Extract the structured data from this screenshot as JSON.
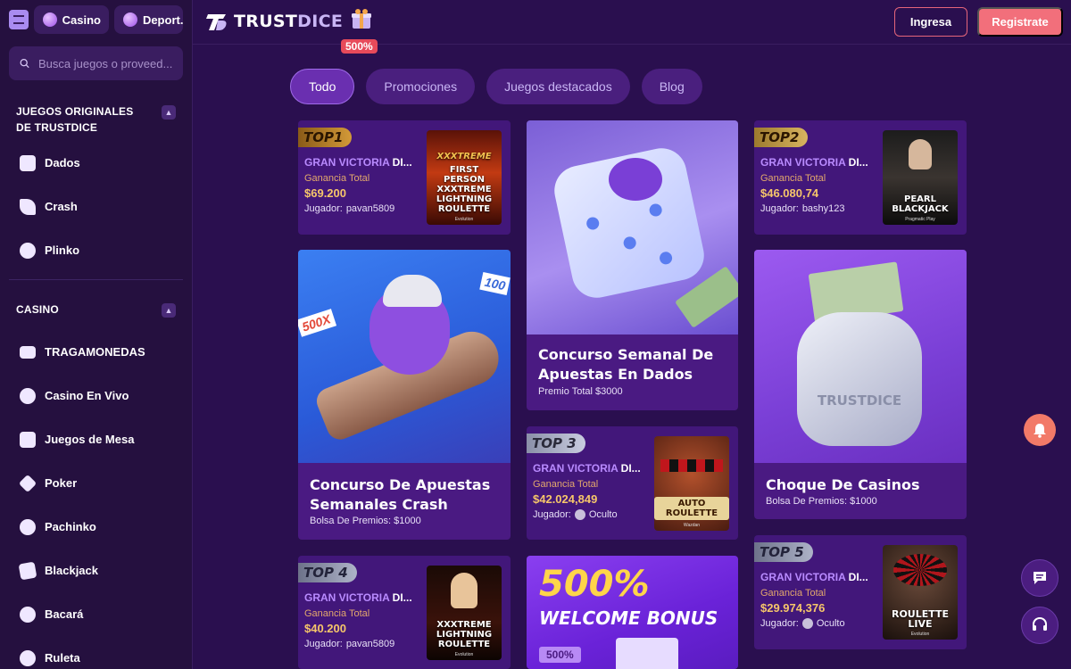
{
  "sidebar": {
    "casino_label": "Casino",
    "sports_label": "Deport...",
    "search_placeholder": "Busca juegos o proveed...",
    "originals_heading": "JUEGOS ORIGINALES DE TRUSTDICE",
    "originals": [
      {
        "label": "Dados",
        "icon": "dice-icon"
      },
      {
        "label": "Crash",
        "icon": "rocket-icon"
      },
      {
        "label": "Plinko",
        "icon": "plinko-icon"
      }
    ],
    "casino_heading": "CASINO",
    "casino_items": [
      {
        "label": "TRAGAMONEDAS",
        "icon": "slots-icon"
      },
      {
        "label": "Casino En Vivo",
        "icon": "live-dealer-icon"
      },
      {
        "label": "Juegos de Mesa",
        "icon": "table-games-icon"
      },
      {
        "label": "Poker",
        "icon": "poker-icon"
      },
      {
        "label": "Pachinko",
        "icon": "pachinko-icon"
      },
      {
        "label": "Blackjack",
        "icon": "cards-icon"
      },
      {
        "label": "Bacará",
        "icon": "club-icon"
      },
      {
        "label": "Ruleta",
        "icon": "roulette-icon"
      }
    ]
  },
  "header": {
    "logo_text_a": "TRUST",
    "logo_text_b": "DICE",
    "gift_badge": "500%",
    "login_label": "Ingresa",
    "register_label": "Registrate"
  },
  "tabs": [
    "Todo",
    "Promociones",
    "Juegos destacados",
    "Blog"
  ],
  "wins": [
    {
      "rank": "TOP1",
      "title_a": "GRAN VICTORIA",
      "title_b": " DI...",
      "label": "Ganancia Total",
      "amount": "$69.200",
      "player_prefix": "Jugador:",
      "player": "pavan5809",
      "game": "FIRST PERSON XXXTREME LIGHTNING ROULETTE",
      "game_tag": "XXXTREME",
      "provider": "Evolution"
    },
    {
      "rank": "TOP2",
      "title_a": "GRAN VICTORIA",
      "title_b": " DI...",
      "label": "Ganancia Total",
      "amount": "$46.080,74",
      "player_prefix": "Jugador:",
      "player": "bashy123",
      "game": "PEARL BLACKJACK",
      "provider": "Pragmatic Play"
    },
    {
      "rank": "TOP 3",
      "title_a": "GRAN VICTORIA",
      "title_b": " DI...",
      "label": "Ganancia Total",
      "amount": "$42.024,849",
      "player_prefix": "Jugador:",
      "player": "Oculto",
      "game": "AUTO ROULETTE",
      "provider": "Wazdan"
    },
    {
      "rank": "TOP 4",
      "title_a": "GRAN VICTORIA",
      "title_b": " DI...",
      "label": "Ganancia Total",
      "amount": "$40.200",
      "player_prefix": "Jugador:",
      "player": "pavan5809",
      "game": "XXXTREME LIGHTNING ROULETTE",
      "provider": "Evolution"
    },
    {
      "rank": "TOP 5",
      "title_a": "GRAN VICTORIA",
      "title_b": " DI...",
      "label": "Ganancia Total",
      "amount": "$29.974,376",
      "player_prefix": "Jugador:",
      "player": "Oculto",
      "game": "ROULETTE LIVE",
      "provider": "Evolution"
    }
  ],
  "promos": {
    "dice": {
      "title": "Concurso Semanal De Apuestas En Dados",
      "sub": "Premio Total $3000"
    },
    "crash": {
      "title": "Concurso De Apuestas Semanales Crash",
      "sub": "Bolsa De Premios: $1000",
      "mult_a": "500X",
      "mult_b": "100"
    },
    "clash": {
      "title": "Choque De Casinos",
      "sub": "Bolsa De Premios: $1000",
      "bag_text": "TRUSTDICE"
    },
    "bonus": {
      "line1": "500%",
      "line2": "WELCOME BONUS",
      "ticket": "500%"
    }
  },
  "colors": {
    "accent": "#f26f7b",
    "bg": "#2a0f4f",
    "card": "#42177a",
    "gold": "#f6c66a"
  }
}
